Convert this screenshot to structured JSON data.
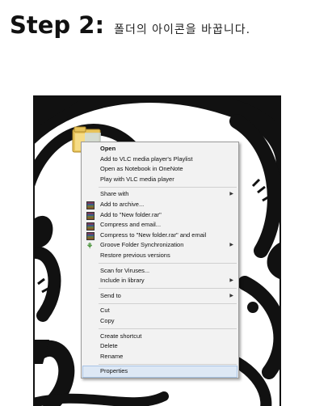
{
  "header": {
    "step_label": "Step 2:",
    "step_desc": "폴더의 아이콘을 바꿉니다."
  },
  "colors": {
    "menu_background": "#f2f2f2",
    "highlight": "#dde8f5",
    "highlight_border": "#a8c4e6",
    "dragon_art": "#111111"
  },
  "context_menu": {
    "items": [
      {
        "label": "Open",
        "bold": true
      },
      {
        "label": "Add to VLC media player's Playlist"
      },
      {
        "label": "Open as Notebook in OneNote"
      },
      {
        "label": "Play with VLC media player"
      },
      {
        "separator": true
      },
      {
        "label": "Share with",
        "submenu": true
      },
      {
        "label": "Add to archive...",
        "icon": "winrar-icon"
      },
      {
        "label": "Add to \"New folder.rar\"",
        "icon": "winrar-icon"
      },
      {
        "label": "Compress and email...",
        "icon": "winrar-icon"
      },
      {
        "label": "Compress to \"New folder.rar\" and email",
        "icon": "winrar-icon"
      },
      {
        "label": "Groove Folder Synchronization",
        "icon": "groove-icon",
        "submenu": true
      },
      {
        "label": "Restore previous versions"
      },
      {
        "separator": true
      },
      {
        "label": "Scan for Viruses..."
      },
      {
        "label": "Include in library",
        "submenu": true
      },
      {
        "separator": true
      },
      {
        "label": "Send to",
        "submenu": true
      },
      {
        "separator": true
      },
      {
        "label": "Cut"
      },
      {
        "label": "Copy"
      },
      {
        "separator": true
      },
      {
        "label": "Create shortcut"
      },
      {
        "label": "Delete"
      },
      {
        "label": "Rename"
      },
      {
        "separator": true
      },
      {
        "label": "Properties",
        "highlighted": true
      }
    ]
  }
}
